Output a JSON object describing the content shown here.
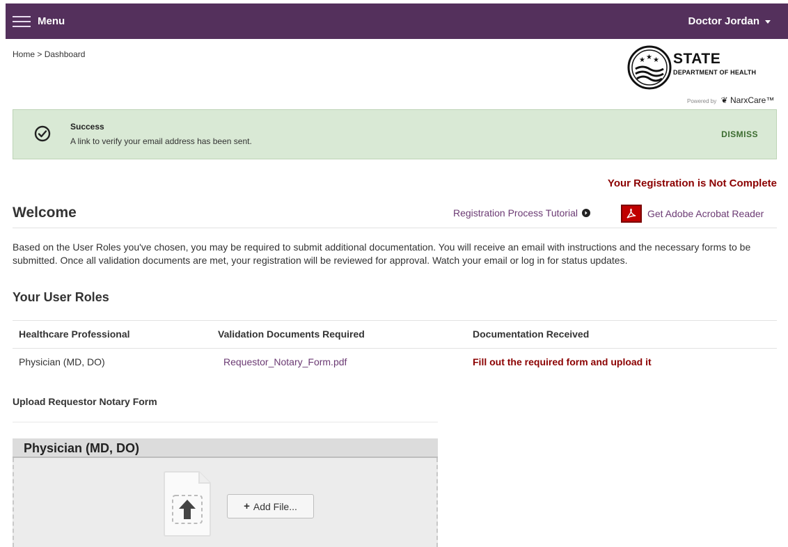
{
  "header": {
    "menu_label": "Menu",
    "user_name": "Doctor Jordan"
  },
  "breadcrumb": {
    "home": "Home",
    "separator": ">",
    "current": "Dashboard"
  },
  "logo": {
    "state": "STATE",
    "department": "DEPARTMENT OF HEALTH",
    "powered_prefix": "Powered by",
    "powered_brand": "NarxCare™"
  },
  "alert": {
    "title": "Success",
    "message": "A link to verify your email address has been sent.",
    "dismiss_label": "DISMISS"
  },
  "registration_status": "Your Registration is Not Complete",
  "welcome": {
    "title": "Welcome",
    "tutorial_link": "Registration Process Tutorial",
    "adobe_link": "Get Adobe Acrobat Reader"
  },
  "intro_text": "Based on the User Roles you've chosen, you may be required to submit additional documentation. You will receive an email with instructions and the necessary forms to be submitted. Once all validation documents are met, your registration will be reviewed for approval. Watch your email or log in for status updates.",
  "roles": {
    "title": "Your User Roles",
    "headers": [
      "Healthcare Professional",
      "Validation Documents Required",
      "Documentation Received"
    ],
    "rows": [
      {
        "role": "Physician (MD, DO)",
        "document": "Requestor_Notary_Form.pdf",
        "status": "Fill out the required form and upload it"
      }
    ]
  },
  "upload": {
    "title": "Upload Requestor Notary Form",
    "panel_title": "Physician (MD, DO)",
    "add_file_label": "Add File..."
  },
  "colors": {
    "topbar": "#54305c",
    "alert_bg": "#d9e9d5",
    "warning": "#8b0000",
    "link": "#6b3a73"
  }
}
